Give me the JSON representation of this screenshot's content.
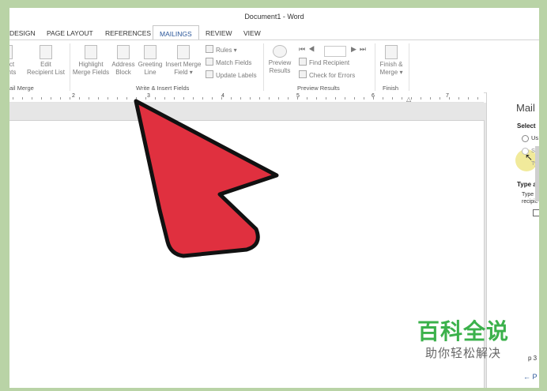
{
  "window": {
    "title": "Document1 - Word"
  },
  "tabs": [
    "DESIGN",
    "PAGE LAYOUT",
    "REFERENCES",
    "MAILINGS",
    "REVIEW",
    "VIEW"
  ],
  "active_tab": "MAILINGS",
  "ribbon": {
    "start_group": {
      "select_partial": "ct",
      "recipients_partial": "nts",
      "edit_line1": "Edit",
      "edit_line2": "Recipient List",
      "label": "ail Merge"
    },
    "write_insert": {
      "highlight_line1": "Highlight",
      "highlight_line2": "Merge Fields",
      "address_line1": "Address",
      "address_line2": "Block",
      "greeting_line1": "Greeting",
      "greeting_line2": "Line",
      "insert_line1": "Insert Merge",
      "insert_line2": "Field",
      "rules": "Rules",
      "match_fields": "Match Fields",
      "update_labels": "Update Labels",
      "label": "Write & Insert Fields"
    },
    "preview": {
      "preview_line1": "Preview",
      "preview_line2": "Results",
      "find_recipient": "Find Recipient",
      "check_errors": "Check for Errors",
      "label": "Preview Results"
    },
    "finish": {
      "finish_line1": "Finish &",
      "finish_line2": "Merge",
      "label": "Finish"
    }
  },
  "ruler": [
    "2",
    "3",
    "4",
    "5",
    "6",
    "7"
  ],
  "pane": {
    "title": "Mail",
    "select": "Select",
    "option1": "Us",
    "option2": "Se",
    "option3": "Ty",
    "type_heading": "Type a",
    "type_text1": "Type t",
    "type_text2": "recipie",
    "step": "p 3",
    "back": "← P"
  },
  "watermark": {
    "title": "百科全说",
    "subtitle": "助你轻松解决"
  },
  "colors": {
    "arrow_fill": "#e0303f",
    "arrow_stroke": "#111111",
    "watermark_green": "#3bb14b",
    "accent": "#2b579a"
  }
}
